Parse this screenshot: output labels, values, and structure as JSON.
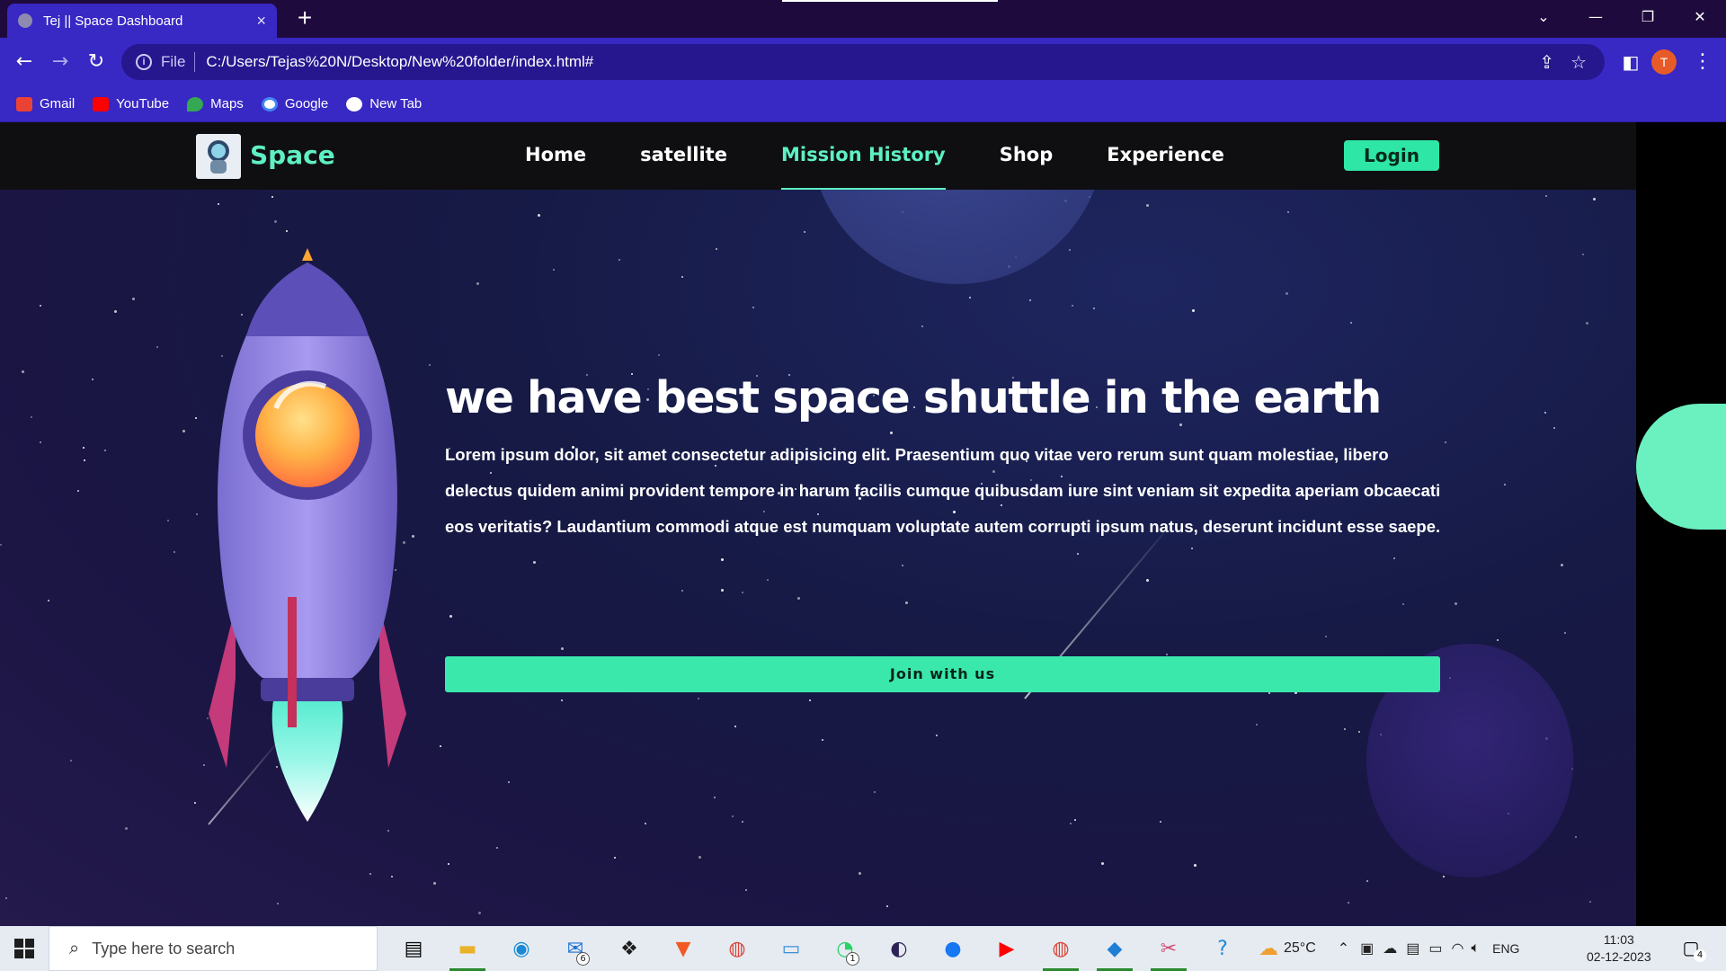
{
  "browser": {
    "tab_title": "Tej || Space Dashboard",
    "tab_close": "×",
    "new_tab": "+",
    "url_scheme": "File",
    "url": "C:/Users/Tejas%20N/Desktop/New%20folder/index.html#",
    "profile_initial": "T",
    "bookmarks": [
      {
        "label": "Gmail",
        "icon": "gmail-icon",
        "color": "#ea4335"
      },
      {
        "label": "YouTube",
        "icon": "youtube-icon",
        "color": "#ff0000"
      },
      {
        "label": "Maps",
        "icon": "maps-icon",
        "color": "#34a853"
      },
      {
        "label": "Google",
        "icon": "google-icon",
        "color": "#4285f4"
      },
      {
        "label": "New Tab",
        "icon": "globe-icon",
        "color": "#ffffff"
      }
    ]
  },
  "site": {
    "logo_text": "Space",
    "nav": [
      {
        "label": "Home",
        "active": false
      },
      {
        "label": "satellite",
        "active": false
      },
      {
        "label": "Mission History",
        "active": true
      },
      {
        "label": "Shop",
        "active": false
      },
      {
        "label": "Experience",
        "active": false
      }
    ],
    "login_label": "Login",
    "headline": "we have best space shuttle in the earth",
    "body": "Lorem ipsum dolor, sit amet consectetur adipisicing elit. Praesentium quo vitae vero rerum sunt quam molestiae, libero delectus quidem animi provident tempore in harum facilis cumque quibusdam iure sint veniam sit expedita aperiam obcaecati eos veritatis? Laudantium commodi atque est numquam voluptate autem corrupti ipsum natus, deserunt incidunt esse saepe.",
    "cta_label": "Join with us",
    "colors": {
      "accent": "#2ee6a6",
      "nav_bg": "#0f0f12",
      "page_bg": "#161a45"
    }
  },
  "taskbar": {
    "search_placeholder": "Type here to search",
    "weather": "25°C",
    "language": "ENG",
    "time": "11:03",
    "date": "02-12-2023",
    "mail_badge": "6",
    "whatsapp_badge": "1",
    "notification_count": "4"
  }
}
